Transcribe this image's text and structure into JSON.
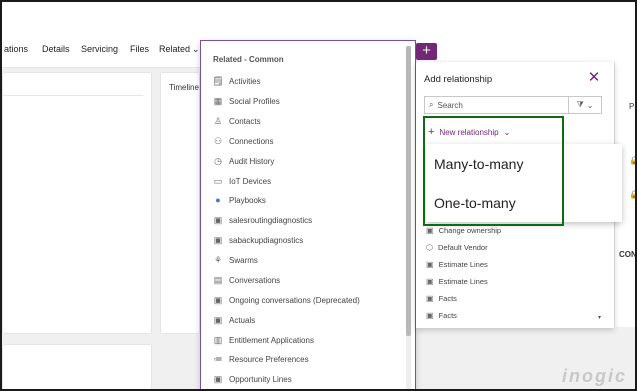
{
  "tabs": [
    "ations",
    "Details",
    "Servicing",
    "Files",
    "Related"
  ],
  "timeline_label": "Timeline",
  "related_panel": {
    "header": "Related - Common",
    "items": [
      {
        "label": "Activities",
        "icon": "activities-icon"
      },
      {
        "label": "Social Profiles",
        "icon": "social-profiles-icon"
      },
      {
        "label": "Contacts",
        "icon": "contacts-icon"
      },
      {
        "label": "Connections",
        "icon": "connections-icon"
      },
      {
        "label": "Audit History",
        "icon": "audit-history-icon"
      },
      {
        "label": "IoT Devices",
        "icon": "iot-devices-icon"
      },
      {
        "label": "Playbooks",
        "icon": "playbooks-icon"
      },
      {
        "label": "salesroutingdiagnostics",
        "icon": "entity-icon"
      },
      {
        "label": "sabackupdiagnostics",
        "icon": "entity-icon"
      },
      {
        "label": "Swarms",
        "icon": "swarms-icon"
      },
      {
        "label": "Conversations",
        "icon": "conversations-icon"
      },
      {
        "label": "Ongoing conversations (Deprecated)",
        "icon": "entity-icon"
      },
      {
        "label": "Actuals",
        "icon": "entity-icon"
      },
      {
        "label": "Entitlement Applications",
        "icon": "entitlement-icon"
      },
      {
        "label": "Resource Preferences",
        "icon": "resource-preferences-icon"
      },
      {
        "label": "Opportunity Lines",
        "icon": "entity-icon"
      }
    ]
  },
  "add_relationship": {
    "title": "Add relationship",
    "search_placeholder": "Search",
    "new_relationship_label": "New relationship",
    "dropdown_options": [
      "Many-to-many",
      "One-to-many"
    ],
    "list": [
      "Change ownership",
      "Default Vendor",
      "Estimate Lines",
      "Estimate Lines",
      "Facts",
      "Facts"
    ]
  },
  "right_stub": {
    "label_top": "Pr",
    "label_mid": "CONT"
  },
  "watermark": "inogic",
  "colors": {
    "accent": "#742774",
    "highlight_box": "#0e6a14"
  }
}
